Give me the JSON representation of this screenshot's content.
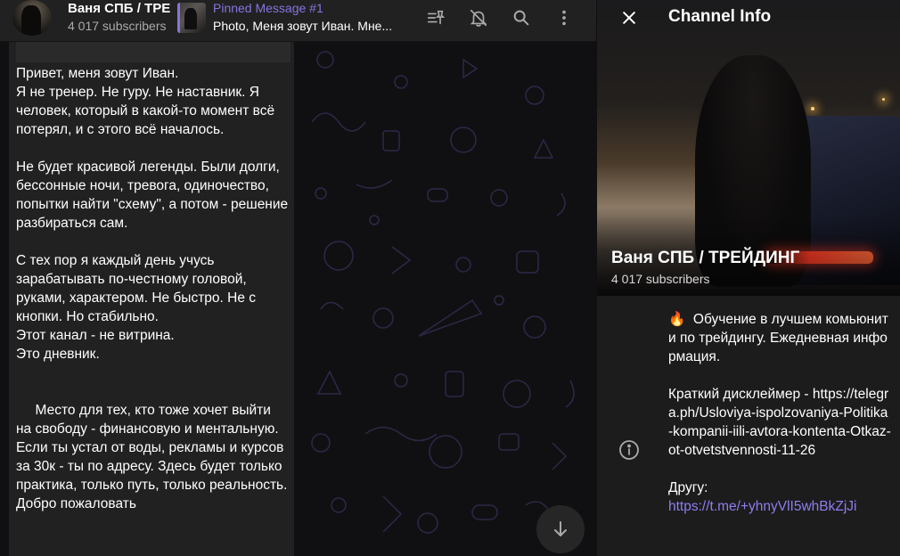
{
  "header": {
    "title": "Ваня СПБ / ТРЕЙДИНГ",
    "subscribers": "4 017 subscribers",
    "pinned_title": "Pinned Message #1",
    "pinned_text": "Photo, Меня зовут Иван. Мне..."
  },
  "icons": {
    "pinned_list": "pinned-list-icon",
    "mute": "bell-off-icon",
    "search": "search-icon",
    "more": "more-vertical-icon",
    "scroll": "arrow-down-icon",
    "close": "close-icon",
    "info": "info-icon"
  },
  "message": {
    "text": "Привет, меня зовут Иван.\nЯ не тренер. Не гуру. Не наставник. Я человек, который в какой-то момент всё потерял, и с этого всё началось.\n\nНе будет красивой легенды. Были долги, бессонные ночи, тревога, одиночество, попытки найти \"схему\", а потом - решение разбираться сам.\n\nС тех пор я каждый день учусь зарабатывать по-честному головой, руками, характером. Не быстро. Не с кнопки. Но стабильно.\nЭтот канал - не витрина.\nЭто дневник.\n\n\n     Место для тех, кто тоже хочет выйти на свободу - финансовую и ментальную.\nЕсли ты устал от воды, рекламы и курсов за 30к - ты по адресу. Здесь будет только практика, только путь, только реальность.\nДобро пожаловать"
  },
  "info_panel": {
    "header_title": "Channel Info",
    "channel_name": "Ваня СПБ / ТРЕЙДИНГ",
    "subscribers": "4 017 subscribers",
    "desc_emoji": "🔥",
    "desc_line1": "  Обучение в лучшем комьюнити по трейдингу. Ежедневная информация.\n\nКраткий дисклеймер - https://telegra.ph/Usloviya-ispolzovaniya-Politika-kompanii-iili-avtora-kontenta-Otkaz-ot-otvetstvennosti-11-26\n\nДругу:\n",
    "friend_link": "https://t.me/+yhnyVlI5whBkZjJi"
  },
  "colors": {
    "accent": "#8774e1",
    "link": "#8d7ef0",
    "panel_bg": "#1c1c1c",
    "bubble_bg": "#212121",
    "header_bg": "#212121"
  }
}
